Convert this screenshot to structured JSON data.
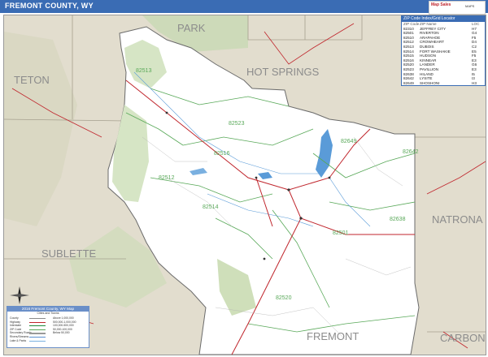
{
  "title": "FREMONT COUNTY, WY",
  "logo": {
    "brand": "Map Sales",
    "tagline": "MAPS"
  },
  "neighbors": [
    {
      "name": "PARK"
    },
    {
      "name": "HOT SPRINGS"
    },
    {
      "name": "TETON"
    },
    {
      "name": "NATRONA"
    },
    {
      "name": "SUBLETTE"
    },
    {
      "name": "FREMONT"
    },
    {
      "name": "CARBON"
    }
  ],
  "zip_labels": [
    "82513",
    "82523",
    "82516",
    "82649",
    "82642",
    "82512",
    "82514",
    "82501",
    "82638",
    "82520"
  ],
  "zip_table": {
    "header": "ZIP Code Index/Grid Locator",
    "columns": [
      "ZIP Code",
      "ZIP Name",
      "LOC"
    ],
    "rows": [
      [
        "82310",
        "JEFFREY CITY",
        "H7"
      ],
      [
        "82501",
        "RIVERTON",
        "G4"
      ],
      [
        "82510",
        "ARAPAHOE",
        "F5"
      ],
      [
        "82512",
        "CROWHEART",
        "D4"
      ],
      [
        "82513",
        "DUBOIS",
        "C2"
      ],
      [
        "82514",
        "FORT WASHAKIE",
        "E5"
      ],
      [
        "82515",
        "HUDSON",
        "F5"
      ],
      [
        "82516",
        "KINNEAR",
        "E3"
      ],
      [
        "82520",
        "LANDER",
        "G6"
      ],
      [
        "82523",
        "PAVILLION",
        "E3"
      ],
      [
        "82638",
        "HILAND",
        "I5"
      ],
      [
        "82642",
        "LYSITE",
        "I3"
      ],
      [
        "82649",
        "SHOSHONI",
        "H3"
      ]
    ]
  },
  "legend": {
    "title": "2016 Fremont County, WY Map",
    "subtitle": "Cities and Towns",
    "items": [
      {
        "label": "County",
        "color": "#8a8a8a"
      },
      {
        "label": "Highway",
        "color": "#c0262d"
      },
      {
        "label": "Interstate",
        "color": "#1f8a3a"
      },
      {
        "label": "ZIP Code",
        "color": "#58a858"
      },
      {
        "label": "Secondary Roads",
        "color": "#999999"
      },
      {
        "label": "Rivers/Streams",
        "color": "#5a8fd0"
      },
      {
        "label": "Lake & Parks",
        "color": "#7ab0e0"
      },
      {
        "label": "State Highways",
        "color": "#c88a8a"
      }
    ],
    "cities": [
      "Above 1,000,000",
      "500,000-1,000,000",
      "100,000-500,000",
      "50,000-100,000",
      "Below 50,000"
    ]
  },
  "colors": {
    "title_bar": "#3a6cb4",
    "county_fill": "#ffffff",
    "outside_fill": "#e2ddce",
    "park_fill": "#b9d3a8",
    "zip_line": "#58a858",
    "highway": "#c0262d",
    "water": "#5a9bd8"
  }
}
